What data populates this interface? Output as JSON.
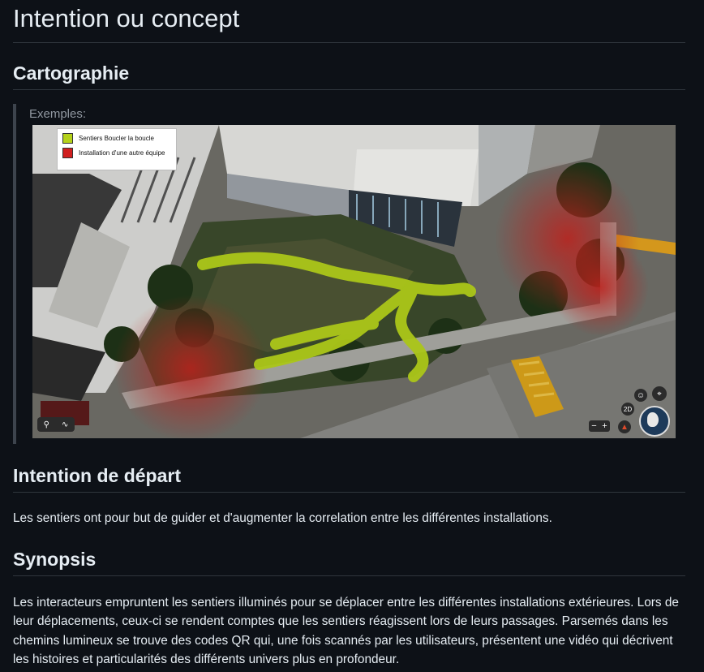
{
  "page": {
    "title": "Intention ou concept",
    "section_cartographie": "Cartographie",
    "examples_label": "Exemples:",
    "legend": [
      {
        "label": "Sentiers Boucler la boucle",
        "color": "#b5d21b"
      },
      {
        "label": "Installation d'une autre équipe",
        "color": "#d01f1f"
      }
    ],
    "map_controls": {
      "zoom_minus": "−",
      "zoom_plus": "+",
      "mode_2d": "2D"
    },
    "section_intention": "Intention de départ",
    "intention_text": "Les sentiers ont pour but de guider et d'augmenter la correlation entre les différentes installations.",
    "section_synopsis": "Synopsis",
    "synopsis_text": "Les interacteurs empruntent les sentiers illuminés pour se déplacer entre les différentes installations extérieures. Lors de leur déplacements, ceux-ci se rendent comptes que les sentiers réagissent lors de leurs passages. Parsemés dans les chemins lumineux se trouve des codes QR qui, une fois scannés par les utilisateurs, présentent une vidéo qui décrivent les histoires et particularités des différents univers plus en profondeur."
  }
}
